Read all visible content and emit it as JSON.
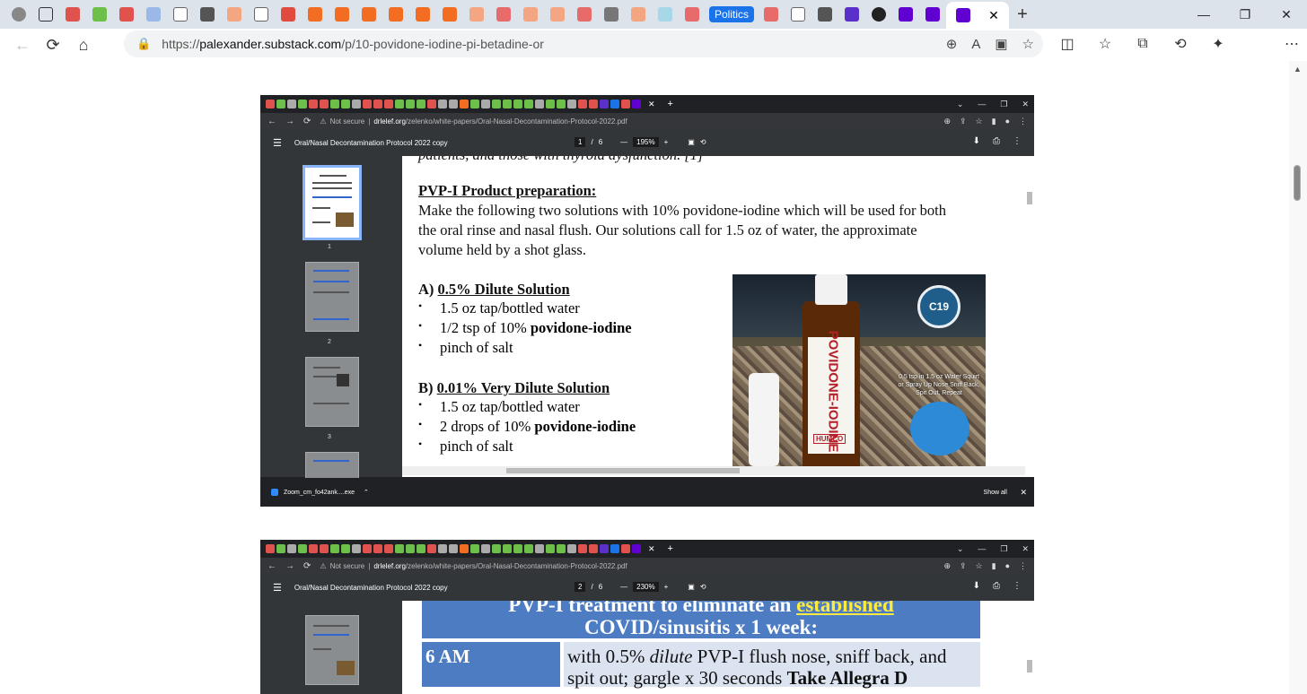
{
  "browser": {
    "tab_label_politics": "Politics",
    "url_prefix": "https://",
    "url_domain": "palexander.substack.com",
    "url_path": "/p/10-povidone-iodine-pi-betadine-or"
  },
  "shot1": {
    "inner_url_notsecure": "Not secure",
    "inner_url_domain": "drlelef.org",
    "inner_url_path": "/zelenko/white-papers/Oral-Nasal-Decontamination-Protocol-2022.pdf",
    "pdf_title": "Oral/Nasal Decontamination Protocol 2022 copy",
    "page_current": "1",
    "page_total": "6",
    "zoom": "195%",
    "thumbs": [
      "1",
      "2",
      "3"
    ],
    "doc": {
      "cut_line": "patients, and those with thyroid dysfunction. [1]",
      "heading": "PVP-I Product preparation:",
      "intro_l1": "Make the following two solutions with 10% povidone-iodine which will be used for both",
      "intro_l2": "the oral rinse and nasal flush. Our solutions call for 1.5 oz of water, the approximate",
      "intro_l3": "volume held by a shot glass.",
      "a_prefix": "A)",
      "a_title": "0.5% Dilute Solution",
      "a_items": [
        "1.5 oz tap/bottled water",
        "1/2 tsp of 10% ",
        "pinch of salt"
      ],
      "a_bold": "povidone-iodine",
      "b_prefix": "B)",
      "b_title": "0.01% Very Dilute Solution",
      "b_items": [
        "1.5 oz tap/bottled water",
        "2 drops of 10% ",
        "pinch of salt"
      ],
      "b_bold": "povidone-iodine",
      "photo_badge": "C19",
      "photo_note": "0.5 tsp in 1.5 oz Water Squirt or Spray Up Nose Sniff Back, Spit Out, Repeat",
      "photo_label": "POVIDONE-IODINE",
      "photo_brand": "HUMCO"
    },
    "download_file": "Zoom_cm_fo42ank....exe",
    "show_all": "Show all"
  },
  "shot2": {
    "inner_url_notsecure": "Not secure",
    "inner_url_domain": "drlelef.org",
    "inner_url_path": "/zelenko/white-papers/Oral-Nasal-Decontamination-Protocol-2022.pdf",
    "pdf_title": "Oral/Nasal Decontamination Protocol 2022 copy",
    "page_current": "2",
    "page_total": "6",
    "zoom": "230%",
    "table_hdr_l1a": "PVP-I treatment to eliminate an ",
    "table_hdr_l1b": "established",
    "table_hdr_l2": "COVID/sinusitis x 1 week:",
    "row_time": "6 AM",
    "row_text_a": "with 0.5% ",
    "row_text_i": "dilute",
    "row_text_b": " PVP-I flush nose, sniff back, and",
    "row_text_c": "spit out; gargle x 30 seconds ",
    "row_text_d": "Take Allegra D"
  }
}
